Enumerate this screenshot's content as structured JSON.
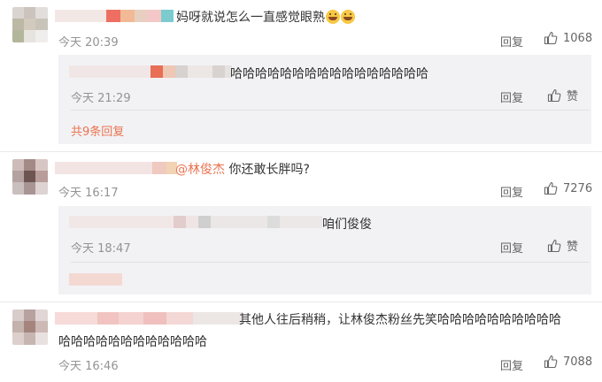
{
  "comments": [
    {
      "text": "妈呀就说怎么一直感觉眼熟",
      "time": "今天 20:39",
      "reply_label": "回复",
      "likes": "1068",
      "icon": "thumbs-up-icon",
      "replies": [
        {
          "text": "哈哈哈哈哈哈哈哈哈哈哈哈哈哈哈哈",
          "time": "今天 21:29",
          "reply_label": "回复",
          "like_label": "赞"
        }
      ],
      "more_replies": "共9条回复"
    },
    {
      "mention": "@林俊杰",
      "text": "你还敢长胖吗?",
      "time": "今天 16:17",
      "reply_label": "回复",
      "likes": "7276",
      "icon": "thumbs-up-icon",
      "replies": [
        {
          "text": "咱们俊俊",
          "time": "今天 18:47",
          "reply_label": "回复",
          "like_label": "赞"
        }
      ]
    },
    {
      "text_line1": "其他人往后稍稍，让林俊杰粉丝先笑哈哈哈哈哈哈哈哈哈哈",
      "text_line2": "哈哈哈哈哈哈哈哈哈哈哈哈",
      "time": "今天 16:46",
      "reply_label": "回复",
      "likes": "7088",
      "icon": "thumbs-up-icon"
    }
  ]
}
